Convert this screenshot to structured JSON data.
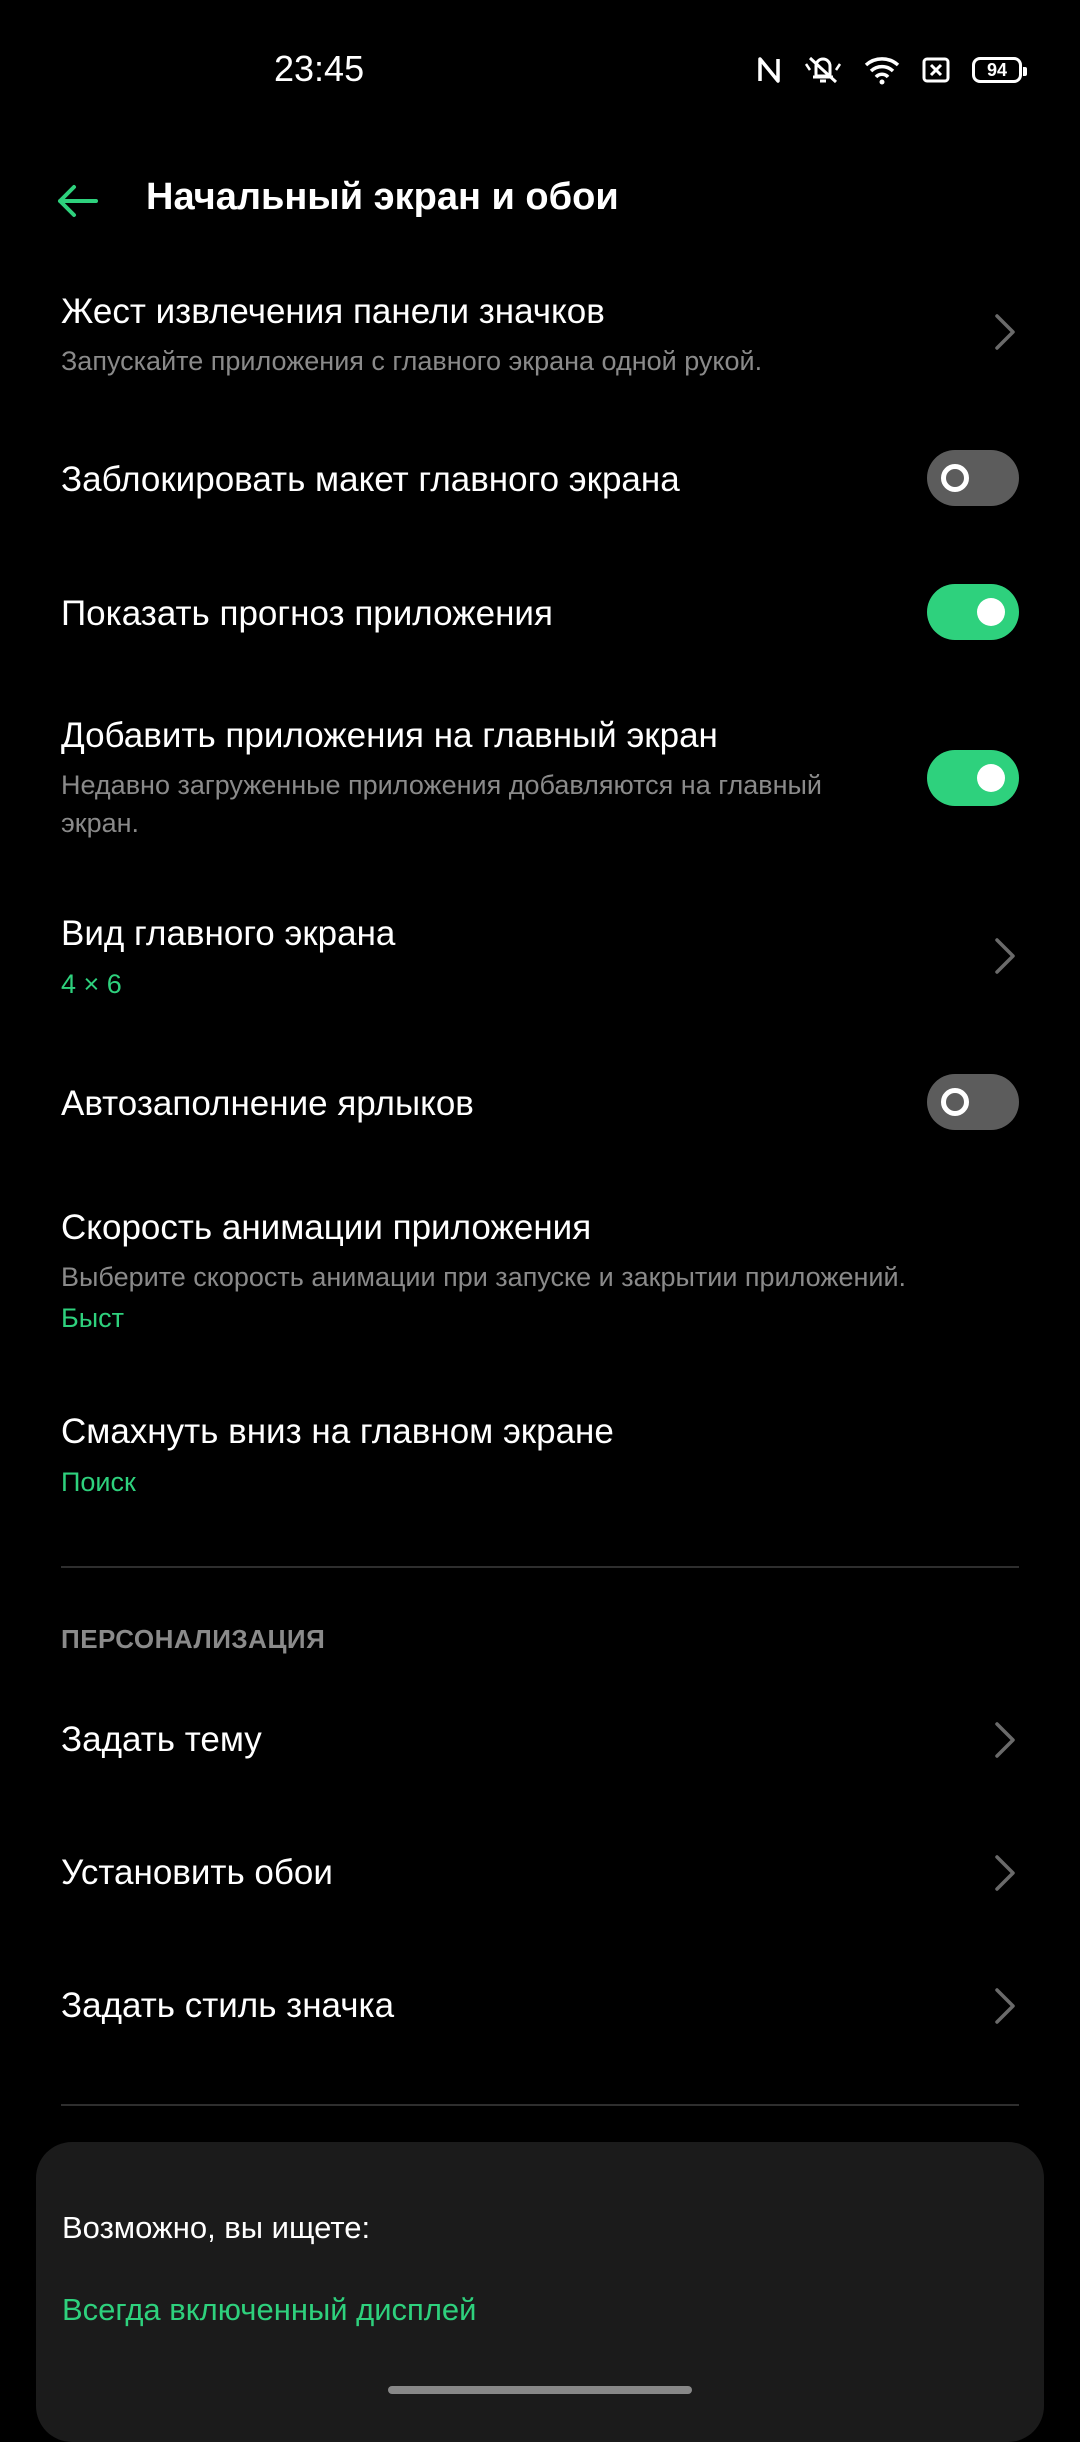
{
  "status_bar": {
    "time": "23:45",
    "battery": "94",
    "icons": [
      "nfc-icon",
      "mute-icon",
      "wifi-icon",
      "close-box-icon",
      "battery-icon"
    ]
  },
  "header": {
    "back_icon": "arrow-left-icon",
    "title": "Начальный экран и обои"
  },
  "settings": [
    {
      "title": "Жест извлечения панели значков",
      "subtitle": "Запускайте приложения с главного экрана одной рукой.",
      "control": "chevron"
    },
    {
      "title": "Заблокировать макет главного экрана",
      "control": "toggle",
      "enabled": false
    },
    {
      "title": "Показать прогноз приложения",
      "control": "toggle",
      "enabled": true
    },
    {
      "title": "Добавить приложения на главный экран",
      "subtitle_line1": "Недавно загруженные приложения добавляются на главный",
      "subtitle_line2": "экран.",
      "control": "toggle",
      "enabled": true
    },
    {
      "title": "Вид главного экрана",
      "value": "4 × 6",
      "control": "chevron"
    },
    {
      "title": "Автозаполнение ярлыков",
      "control": "toggle",
      "enabled": false
    },
    {
      "title": "Скорость анимации приложения",
      "subtitle": "Выберите скорость анимации при запуске и закрытии приложений.",
      "value": "Быст",
      "control": "none"
    },
    {
      "title": "Смахнуть вниз на главном экране",
      "value": "Поиск",
      "control": "none"
    }
  ],
  "personalization": {
    "label": "ПЕРСОНАЛИЗАЦИЯ",
    "items": [
      {
        "title": "Задать тему",
        "control": "chevron"
      },
      {
        "title": "Установить обои",
        "control": "chevron"
      },
      {
        "title": "Задать стиль значка",
        "control": "chevron"
      }
    ]
  },
  "suggestion_card": {
    "label": "Возможно, вы ищете:",
    "link": "Всегда включенный дисплей"
  },
  "colors": {
    "accent": "#2ed17d",
    "background": "#000000",
    "toggle_off": "#5c5c5c",
    "secondary_text": "#8a8a8a",
    "card": "#1b1b1b"
  }
}
